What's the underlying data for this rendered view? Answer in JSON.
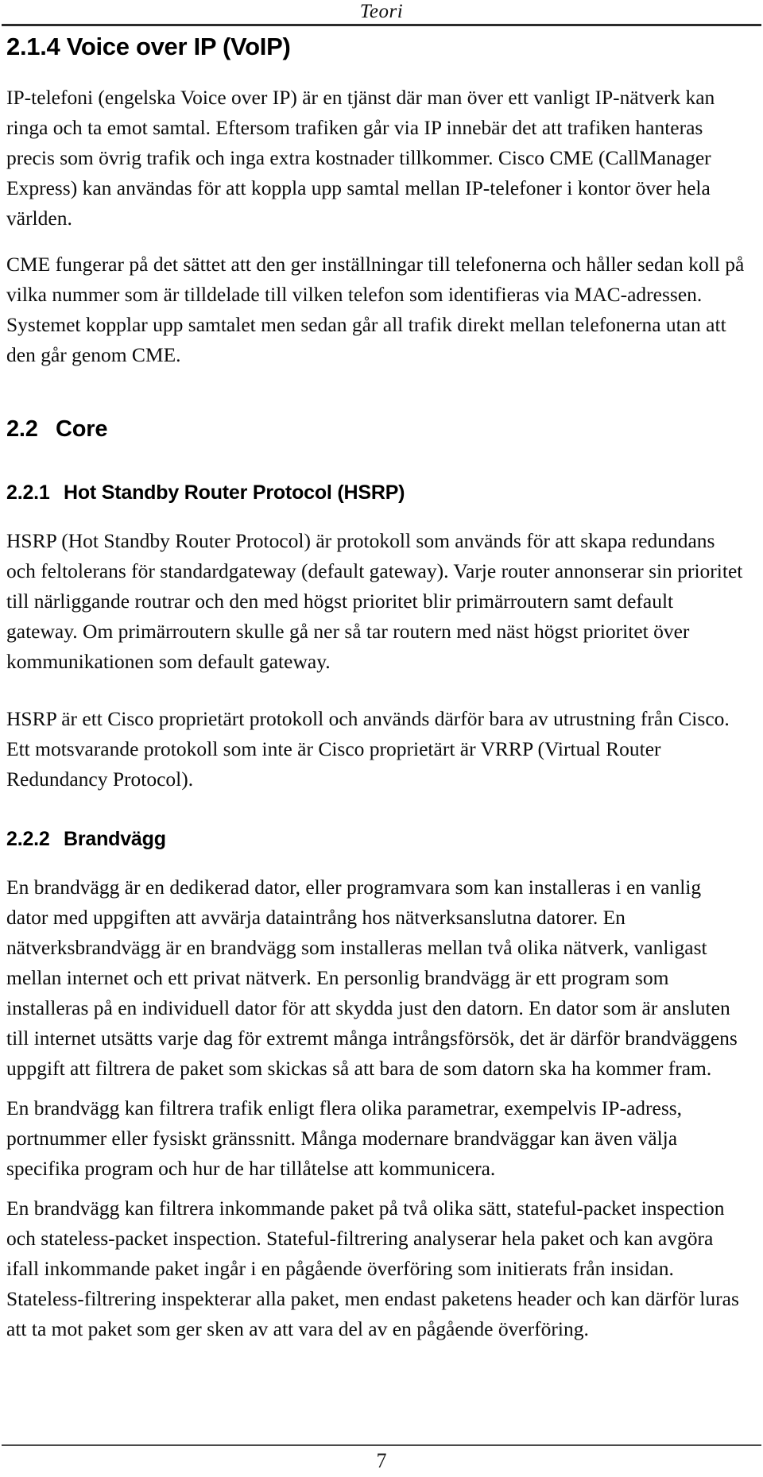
{
  "header": {
    "title": "Teori"
  },
  "footer": {
    "page_number": "7"
  },
  "sections": {
    "voip": {
      "number": "2.1.4",
      "title": "Voice over IP (VoIP)",
      "heading": "2.1.4 Voice over IP (VoIP)",
      "paragraphs": [
        "IP-telefoni (engelska Voice over IP) är en tjänst där man över ett vanligt IP-nätverk kan ringa och ta emot samtal. Eftersom trafiken går via IP innebär det att trafiken hanteras precis som övrig trafik och inga extra kostnader tillkommer. Cisco CME (CallManager Express) kan användas för att koppla upp samtal mellan IP-telefoner i kontor över hela världen.",
        "CME fungerar på det sättet att den ger inställningar till telefonerna och håller sedan koll på vilka nummer som är tilldelade till vilken telefon som identifieras via MAC-adressen. Systemet kopplar upp samtalet men sedan går all trafik direkt mellan telefonerna utan att den går genom CME."
      ]
    },
    "core": {
      "number": "2.2",
      "title": "Core"
    },
    "hsrp": {
      "number": "2.2.1",
      "title": "Hot Standby Router Protocol (HSRP)",
      "paragraphs": [
        "HSRP (Hot Standby Router Protocol) är protokoll som används för att skapa redundans och feltolerans för standardgateway (default gateway). Varje router annonserar sin prioritet till närliggande routrar och den med högst prioritet blir primärroutern samt default gateway. Om primärroutern skulle gå ner så tar routern med näst högst prioritet över kommunikationen som default gateway.",
        "HSRP är ett Cisco proprietärt protokoll och används därför bara av utrustning från Cisco. Ett motsvarande protokoll som inte är Cisco proprietärt är VRRP (Virtual Router Redundancy Protocol)."
      ]
    },
    "brandvagg": {
      "number": "2.2.2",
      "title": "Brandvägg",
      "paragraphs": [
        "En brandvägg är en dedikerad dator, eller programvara som kan installeras i en vanlig dator med uppgiften att avvärja dataintrång hos nätverksanslutna datorer. En nätverksbrandvägg är en brandvägg som installeras mellan två olika nätverk, vanligast mellan internet och ett privat nätverk. En personlig brandvägg är ett program som installeras på en individuell dator för att skydda just den datorn. En dator som är ansluten till internet utsätts varje dag för extremt många intrångsförsök, det är därför brandväggens uppgift att filtrera de paket som skickas så att bara de som datorn ska ha kommer fram.",
        "En brandvägg kan filtrera trafik enligt flera olika parametrar, exempelvis IP-adress, portnummer eller fysiskt gränssnitt. Många modernare brandväggar kan även välja specifika program och hur de har tillåtelse att kommunicera.",
        "En brandvägg kan filtrera inkommande paket på två olika sätt, stateful-packet inspection och stateless-packet inspection. Stateful-filtrering analyserar hela paket och kan avgöra ifall inkommande paket ingår i en pågående överföring som initierats från insidan. Stateless-filtrering inspekterar alla paket, men endast paketens header och kan därför luras att ta mot paket som ger sken av att vara del av en pågående överföring."
      ]
    }
  }
}
